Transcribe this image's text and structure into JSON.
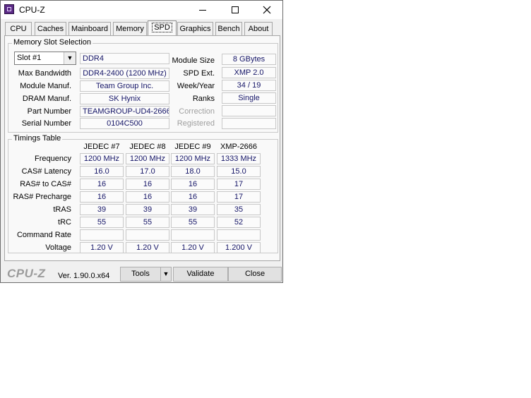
{
  "window": {
    "title": "CPU-Z"
  },
  "tabs": [
    "CPU",
    "Caches",
    "Mainboard",
    "Memory",
    "SPD",
    "Graphics",
    "Bench",
    "About"
  ],
  "active_tab": "SPD",
  "memory_slot": {
    "group_title": "Memory Slot Selection",
    "slot_selected": "Slot #1",
    "type": "DDR4",
    "left": [
      {
        "label": "Max Bandwidth",
        "value": "DDR4-2400 (1200 MHz)"
      },
      {
        "label": "Module Manuf.",
        "value": "Team Group Inc."
      },
      {
        "label": "DRAM Manuf.",
        "value": "SK Hynix"
      },
      {
        "label": "Part Number",
        "value": "TEAMGROUP-UD4-2666"
      },
      {
        "label": "Serial Number",
        "value": "0104C500"
      }
    ],
    "right": [
      {
        "label": "Module Size",
        "value": "8 GBytes"
      },
      {
        "label": "SPD Ext.",
        "value": "XMP 2.0"
      },
      {
        "label": "Week/Year",
        "value": "34 / 19"
      },
      {
        "label": "Ranks",
        "value": "Single"
      },
      {
        "label": "Correction",
        "value": ""
      },
      {
        "label": "Registered",
        "value": ""
      }
    ]
  },
  "timings": {
    "group_title": "Timings Table",
    "columns": [
      "JEDEC #7",
      "JEDEC #8",
      "JEDEC #9",
      "XMP-2666"
    ],
    "rows": [
      {
        "label": "Frequency",
        "values": [
          "1200 MHz",
          "1200 MHz",
          "1200 MHz",
          "1333 MHz"
        ]
      },
      {
        "label": "CAS# Latency",
        "values": [
          "16.0",
          "17.0",
          "18.0",
          "15.0"
        ]
      },
      {
        "label": "RAS# to CAS#",
        "values": [
          "16",
          "16",
          "16",
          "17"
        ]
      },
      {
        "label": "RAS# Precharge",
        "values": [
          "16",
          "16",
          "16",
          "17"
        ]
      },
      {
        "label": "tRAS",
        "values": [
          "39",
          "39",
          "39",
          "35"
        ]
      },
      {
        "label": "tRC",
        "values": [
          "55",
          "55",
          "55",
          "52"
        ]
      },
      {
        "label": "Command Rate",
        "values": [
          "",
          "",
          "",
          ""
        ]
      },
      {
        "label": "Voltage",
        "values": [
          "1.20 V",
          "1.20 V",
          "1.20 V",
          "1.200 V"
        ]
      }
    ]
  },
  "footer": {
    "logo": "CPU-Z",
    "version": "Ver. 1.90.0.x64",
    "tools_label": "Tools",
    "validate_label": "Validate",
    "close_label": "Close"
  },
  "colors": {
    "value_text": "#151567",
    "app_icon": "#5b2a86"
  }
}
